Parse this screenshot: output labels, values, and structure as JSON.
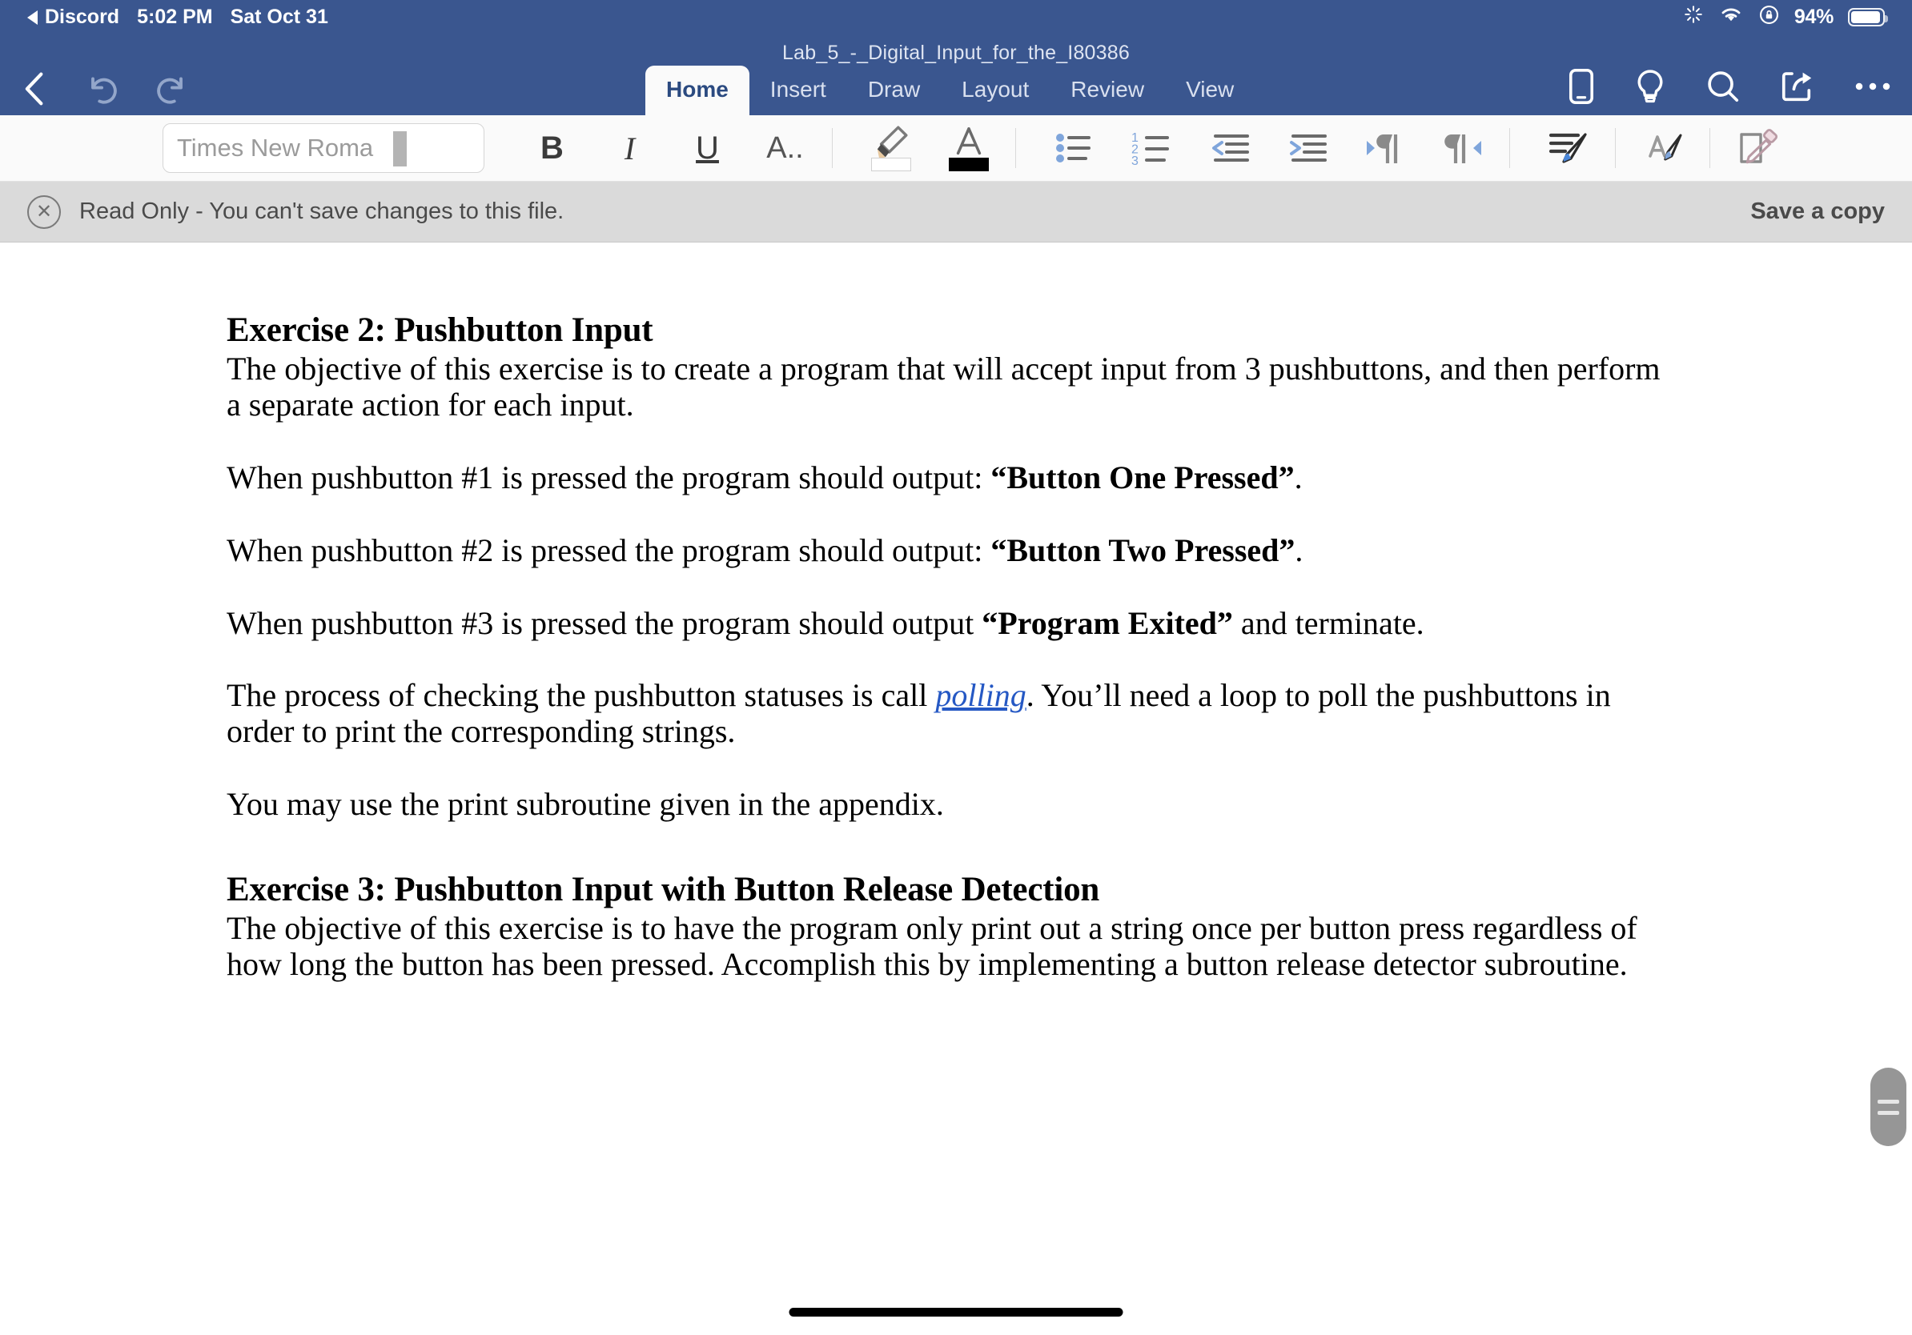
{
  "status_bar": {
    "back_app": "Discord",
    "time": "5:02 PM",
    "date": "Sat Oct 31",
    "icons": [
      "activity-spinner-icon",
      "wifi-icon",
      "rotation-lock-icon"
    ],
    "battery_percent": "94%"
  },
  "header": {
    "document_title": "Lab_5_-_Digital_Input_for_the_I80386",
    "left_icons": [
      {
        "name": "back-chevron-icon",
        "label": "Back"
      },
      {
        "name": "undo-icon",
        "label": "Undo"
      },
      {
        "name": "redo-icon",
        "label": "Redo"
      }
    ],
    "right_icons": [
      {
        "name": "mobile-view-icon",
        "label": "Mobile View"
      },
      {
        "name": "lightbulb-icon",
        "label": "Tell Me"
      },
      {
        "name": "search-icon",
        "label": "Search"
      },
      {
        "name": "share-icon",
        "label": "Share"
      },
      {
        "name": "more-options-icon",
        "label": "More Options"
      }
    ],
    "tabs": [
      {
        "label": "Home",
        "active": true
      },
      {
        "label": "Insert",
        "active": false
      },
      {
        "label": "Draw",
        "active": false
      },
      {
        "label": "Layout",
        "active": false
      },
      {
        "label": "Review",
        "active": false
      },
      {
        "label": "View",
        "active": false
      }
    ],
    "accent_color": "#3a568f",
    "active_tab_color": "#2b4a80"
  },
  "toolbar": {
    "font_name_value": "Times New Roma",
    "buttons": [
      {
        "name": "bold-button",
        "label": "B"
      },
      {
        "name": "italic-button",
        "label": "I"
      },
      {
        "name": "underline-button",
        "label": "U"
      },
      {
        "name": "more-font-options-button",
        "label": "A.."
      },
      {
        "name": "highlight-color-button",
        "label": "Highlight",
        "swatch": "#ffffff"
      },
      {
        "name": "font-color-button",
        "label": "Font Color",
        "swatch": "#000000"
      },
      {
        "name": "bullet-list-button",
        "label": "Bullets"
      },
      {
        "name": "numbered-list-button",
        "label": "Numbering"
      },
      {
        "name": "decrease-indent-button",
        "label": "Decrease Indent"
      },
      {
        "name": "increase-indent-button",
        "label": "Increase Indent"
      },
      {
        "name": "ltr-paragraph-button",
        "label": "Left-to-Right"
      },
      {
        "name": "rtl-paragraph-button",
        "label": "Right-to-Left"
      },
      {
        "name": "paragraph-style-button",
        "label": "Paragraph Styles"
      },
      {
        "name": "text-style-button",
        "label": "Text Styles"
      },
      {
        "name": "clear-formatting-button",
        "label": "Clear Formatting"
      }
    ]
  },
  "banner": {
    "message": "Read Only - You can't save changes to this file.",
    "action_label": "Save a copy",
    "close_icon": "close-circle-icon",
    "background": "#dadada"
  },
  "document": {
    "heading_1": "Exercise 2: Pushbutton Input",
    "para_intro": "The objective of this exercise is to create a program that will accept input from 3 pushbuttons, and then perform a separate action for each input.",
    "para_b1_pre": "When pushbutton #1 is pressed the program should output: ",
    "para_b1_bold": "“Button One Pressed”",
    "para_b1_post": ".",
    "para_b2_pre": "When pushbutton #2 is pressed the program should output: ",
    "para_b2_bold": "“Button Two Pressed”",
    "para_b2_post": ".",
    "para_b3_pre": "When pushbutton #3 is pressed the program should output ",
    "para_b3_bold": "“Program Exited”",
    "para_b3_post": " and terminate.",
    "para_poll_pre": "The process of checking the pushbutton statuses is call ",
    "para_poll_link": "polling",
    "para_poll_post": ". You’ll need a loop to poll the pushbuttons in order to print the corresponding strings.",
    "para_appendix": "You may use the print subroutine given in the appendix.",
    "heading_2": "Exercise 3: Pushbutton Input with Button Release Detection",
    "para_ex3": "The objective of this exercise is to have the program only print out a string once per button press regardless of how long the button has been pressed. Accomplish this by implementing a button release detector subroutine.",
    "link_color": "#2558c4"
  },
  "scroll_grip": {
    "name": "scroll-grip-handle"
  },
  "home_indicator": {
    "name": "home-indicator"
  }
}
